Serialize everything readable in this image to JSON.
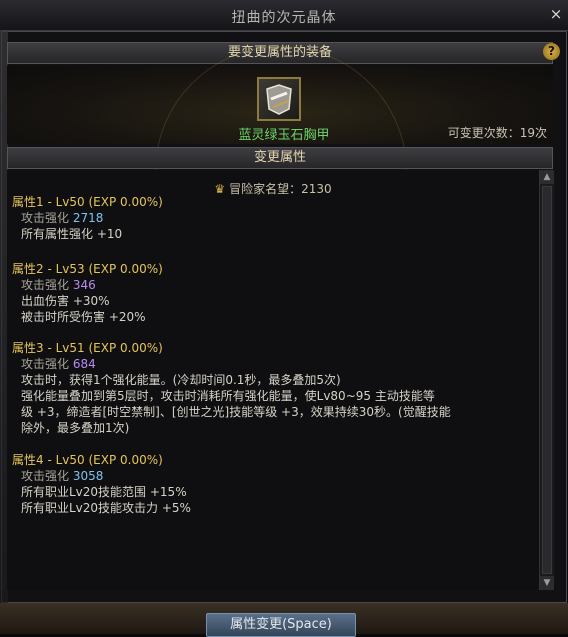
{
  "window": {
    "title": "扭曲的次元晶体",
    "close": "×"
  },
  "equip_section": {
    "header": "要变更属性的装备",
    "help": "?"
  },
  "item": {
    "name": "蓝灵绿玉石胸甲",
    "remaining": "可变更次数：19次"
  },
  "change_section": {
    "header": "变更属性"
  },
  "fame": {
    "label": "冒险家名望：2130"
  },
  "attributes": [
    {
      "title": "属性1 - Lv50 (EXP 0.00%)",
      "attack_label": "攻击强化",
      "attack_value": "2718",
      "lines": [
        "所有属性强化 +10"
      ]
    },
    {
      "title": "属性2 - Lv53 (EXP 0.00%)",
      "attack_label": "攻击强化",
      "attack_value": "346",
      "lines": [
        "出血伤害 +30%",
        "被击时所受伤害 +20%"
      ]
    },
    {
      "title": "属性3 - Lv51 (EXP 0.00%)",
      "attack_label": "攻击强化",
      "attack_value": "684",
      "lines": [
        "攻击时，获得1个强化能量。(冷却时间0.1秒，最多叠加5次)",
        "强化能量叠加到第5层时，攻击时消耗所有强化能量，使Lv80~95 主动技能等",
        "级 +3，缔造者[时空禁制]、[创世之光]技能等级 +3，效果持续30秒。(觉醒技能",
        "除外，最多叠加1次)"
      ]
    },
    {
      "title": "属性4 - Lv50 (EXP 0.00%)",
      "attack_label": "攻击强化",
      "attack_value": "3058",
      "lines": [
        "所有职业Lv20技能范围 +15%",
        "所有职业Lv20技能攻击力 +5%"
      ]
    }
  ],
  "footer": {
    "button": "属性变更(Space)"
  }
}
